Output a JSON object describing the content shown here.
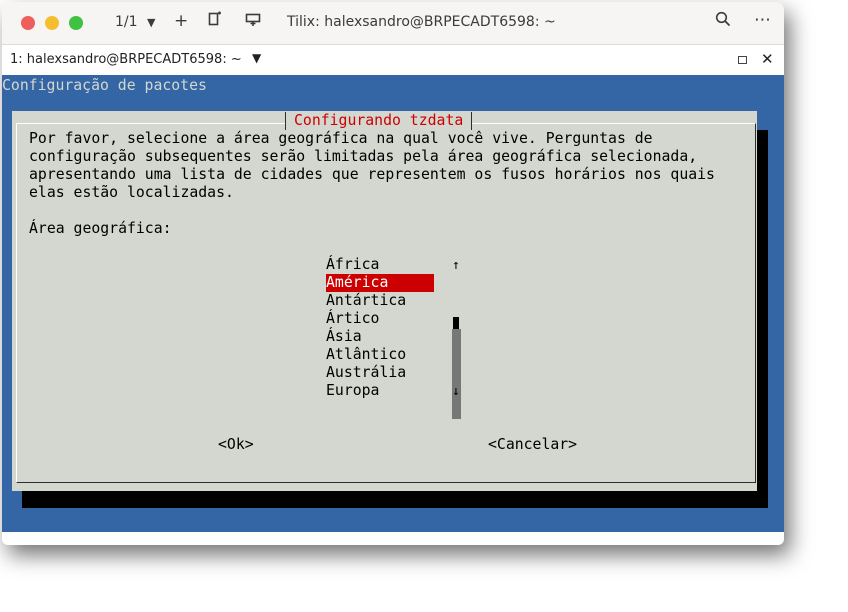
{
  "headerbar": {
    "session_count": "1/1",
    "title": "Tilix: halexsandro@BRPECADT6598: ~",
    "icons": [
      "chevron-down-icon",
      "plus-icon",
      "new-terminal-icon",
      "new-window-icon",
      "search-icon",
      "more-icon"
    ]
  },
  "session": {
    "title": "1: halexsandro@BRPECADT6598: ~"
  },
  "terminal": {
    "backtitle": "Configuração de pacotes",
    "dialog": {
      "title": "Configurando tzdata",
      "description": [
        "Por favor, selecione a área geográfica na qual você vive. Perguntas de",
        "configuração subsequentes serão limitadas pela área geográfica selecionada,",
        "apresentando uma lista de cidades que representem os fusos horários nos quais",
        "elas estão localizadas."
      ],
      "prompt": "Área geográfica:",
      "items": [
        "África",
        "América",
        "Antártica",
        "Ártico",
        "Ásia",
        "Atlântico",
        "Austrália",
        "Europa"
      ],
      "selected_index": 1,
      "scroll_up": "↑",
      "scroll_down": "↓",
      "ok_label": "<Ok>",
      "cancel_label": "<Cancelar>"
    }
  },
  "colors": {
    "terminal_bg": "#3465a4",
    "dialog_bg": "#d3d7cf",
    "accent": "#cc0000"
  }
}
